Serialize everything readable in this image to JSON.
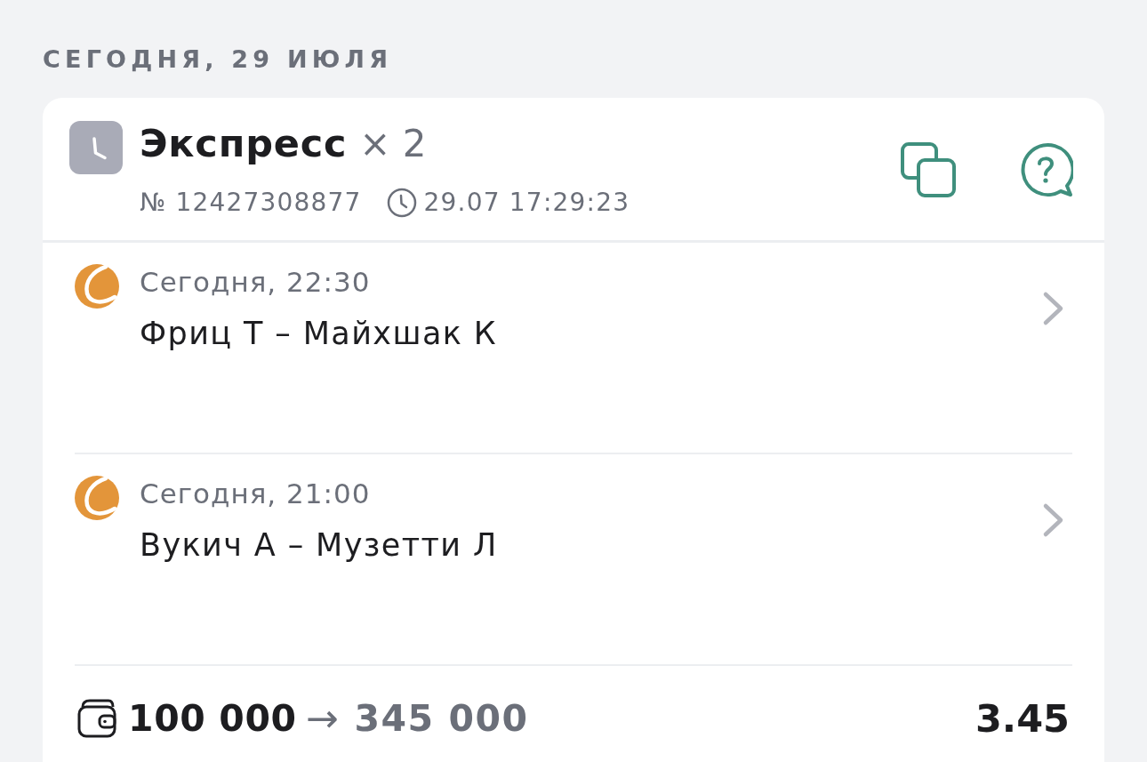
{
  "date_header": "СЕГОДНЯ, 29 ИЮЛЯ",
  "bet": {
    "type": "Экспресс",
    "multiplier": "× 2",
    "number": "№ 12427308877",
    "placed_at": "29.07 17:29:23",
    "events": [
      {
        "time": "Сегодня, 22:30",
        "match": "Фриц Т – Майхшак К"
      },
      {
        "time": "Сегодня, 21:00",
        "match": "Вукич А – Музетти Л"
      }
    ],
    "stake": "100 000",
    "arrow": "→",
    "payout": "345 000",
    "odds": "3.45"
  }
}
